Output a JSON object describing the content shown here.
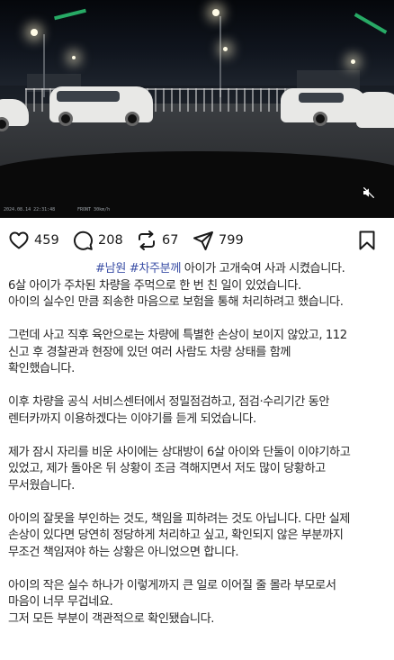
{
  "video": {
    "timestamp_left": "2024.08.14 22:31:48",
    "timestamp_right": "FRONT 30km/h",
    "mute_icon": "speaker-muted-icon"
  },
  "actions": {
    "likes": "459",
    "comments": "208",
    "reposts": "67",
    "shares": "799"
  },
  "post": {
    "hashtag1": "#남원",
    "hashtag2": "#차주분께",
    "line1_rest": " 아이가 고개숙여 사과 시켰습니다.",
    "p1": [
      "6살 아이가 주차된 차량을 주먹으로 한 번 친 일이 있었습니다.",
      "아이의 실수인 만큼 죄송한 마음으로 보험을 통해 처리하려고 했습니다."
    ],
    "p2": [
      "그런데 사고 직후 육안으로는 차량에 특별한 손상이 보이지 않았고, 112",
      "신고 후 경찰관과 현장에 있던 여러 사람도 차량 상태를 함께",
      "확인했습니다."
    ],
    "p3": [
      "이후 차량을 공식 서비스센터에서 정밀점검하고, 점검·수리기간 동안",
      "렌터카까지 이용하겠다는 이야기를 듣게 되었습니다."
    ],
    "p4": [
      "제가 잠시 자리를 비운 사이에는 상대방이 6살 아이와 단둘이 이야기하고",
      "있었고, 제가 돌아온 뒤 상황이 조금 격해지면서 저도 많이 당황하고",
      "무서웠습니다."
    ],
    "p5": [
      "아이의 잘못을 부인하는 것도, 책임을 피하려는 것도 아닙니다. 다만 실제",
      "손상이 있다면 당연히 정당하게 처리하고 싶고, 확인되지 않은 부분까지",
      "무조건 책임져야 하는 상황은 아니었으면 합니다."
    ],
    "p6": [
      "아이의 작은 실수 하나가 이렇게까지 큰 일로 이어질 줄 몰라 부모로서",
      "마음이 너무 무겁네요.",
      "그저 모든 부분이 객관적으로 확인됐습니다."
    ]
  },
  "icons": {
    "like": "heart-icon",
    "comment": "comment-bubble-icon",
    "repost": "repost-arrows-icon",
    "share": "paper-plane-icon",
    "save": "bookmark-icon"
  }
}
